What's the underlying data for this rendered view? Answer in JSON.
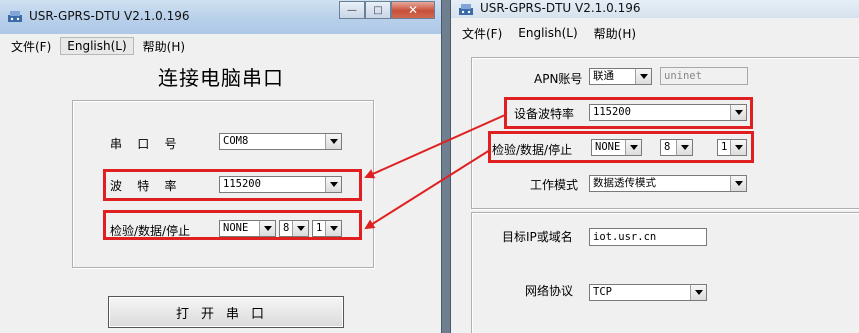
{
  "left_window": {
    "title": "USR-GPRS-DTU V2.1.0.196",
    "menu": [
      "文件(F)",
      "English(L)",
      "帮助(H)"
    ],
    "heading": "连接电脑串口",
    "port_label": "串    口    号",
    "port_value": "COM8",
    "baud_label": "波    特    率",
    "baud_value": "115200",
    "parity_label": "检验/数据/停止",
    "parity_value": "NONE",
    "databits_value": "8",
    "stopbits_value": "1",
    "open_button": "打开串口"
  },
  "right_window": {
    "title": "USR-GPRS-DTU V2.1.0.196",
    "menu": [
      "文件(F)",
      "English(L)",
      "帮助(H)"
    ],
    "apn_label": "APN账号",
    "apn_operator": "联通",
    "apn_value": "uninet",
    "baud_label": "设备波特率",
    "baud_value": "115200",
    "parity_label": "检验/数据/停止",
    "parity_value": "NONE",
    "databits_value": "8",
    "stopbits_value": "1",
    "mode_label": "工作模式",
    "mode_value": "数据透传模式",
    "target_label": "目标IP或域名",
    "target_value": "iot.usr.cn",
    "protocol_label": "网络协议",
    "protocol_value": "TCP"
  },
  "colors": {
    "highlight": "#e02020",
    "titlebar": "#b8d0ea"
  }
}
